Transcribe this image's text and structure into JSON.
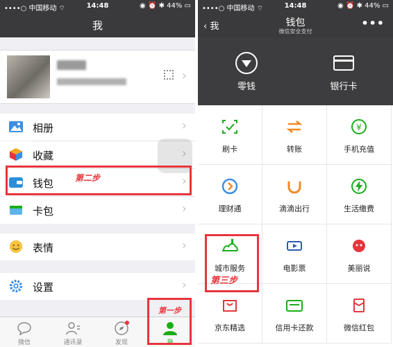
{
  "left": {
    "status": {
      "carrier": "••••○ 中国移动 ⌔",
      "time": "14:48",
      "battery": "◉ ⏰ ✱ 44% ▭"
    },
    "title": "我",
    "menu": [
      {
        "label": "相册"
      },
      {
        "label": "收藏"
      },
      {
        "label": "钱包"
      },
      {
        "label": "卡包"
      },
      {
        "label": "表情"
      },
      {
        "label": "设置"
      }
    ],
    "annotations": {
      "step2": "第二步",
      "step1": "第一步"
    },
    "tabs": [
      {
        "label": "微信"
      },
      {
        "label": "通讯录"
      },
      {
        "label": "发现"
      },
      {
        "label": "我"
      }
    ]
  },
  "right": {
    "status": {
      "carrier": "••••○ 中国移动 ⌔",
      "time": "14:48",
      "battery": "◉ ⏰ ✱ 44% ▭"
    },
    "back_label": "我",
    "title": "钱包",
    "subtitle": "微信安全支付",
    "more": "•••",
    "header": [
      {
        "label": "零钱"
      },
      {
        "label": "银行卡"
      }
    ],
    "services": [
      {
        "label": "刷卡"
      },
      {
        "label": "转账"
      },
      {
        "label": "手机充值"
      },
      {
        "label": "理财通"
      },
      {
        "label": "滴滴出行"
      },
      {
        "label": "生活缴费"
      },
      {
        "label": "城市服务"
      },
      {
        "label": "电影票"
      },
      {
        "label": "美丽说"
      },
      {
        "label": "京东精选"
      },
      {
        "label": "信用卡还款"
      },
      {
        "label": "微信红包"
      }
    ],
    "annotations": {
      "step3": "第三步"
    }
  },
  "colors": {
    "annotation_red": "#e8343b",
    "wechat_green": "#1aad19",
    "dark_bar": "#3a3a3c"
  }
}
